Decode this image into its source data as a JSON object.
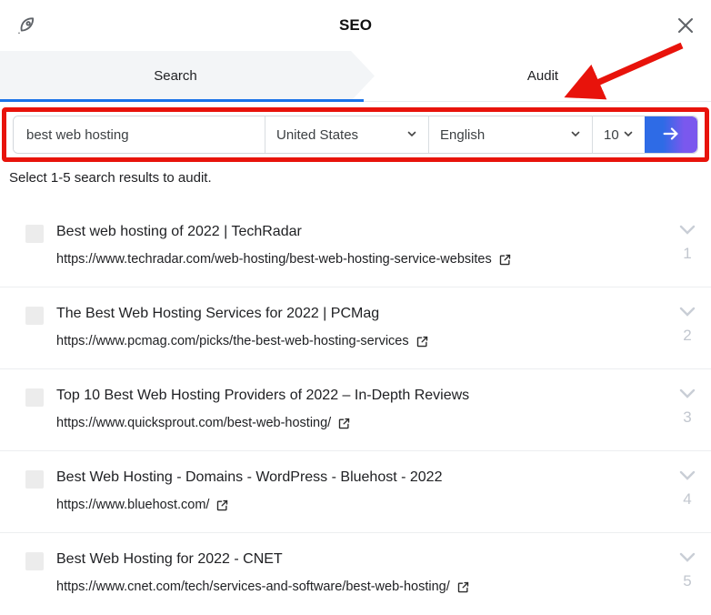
{
  "header": {
    "title": "SEO"
  },
  "tabs": {
    "search_label": "Search",
    "audit_label": "Audit"
  },
  "search": {
    "query": "best web hosting",
    "country": "United States",
    "language": "English",
    "result_count": "10"
  },
  "instruction": "Select 1-5 search results to audit.",
  "results": [
    {
      "rank": "1",
      "title": "Best web hosting of 2022 | TechRadar",
      "url": "https://www.techradar.com/web-hosting/best-web-hosting-service-websites"
    },
    {
      "rank": "2",
      "title": "The Best Web Hosting Services for 2022 | PCMag",
      "url": "https://www.pcmag.com/picks/the-best-web-hosting-services"
    },
    {
      "rank": "3",
      "title": "Top 10 Best Web Hosting Providers of 2022 – In-Depth Reviews",
      "url": "https://www.quicksprout.com/best-web-hosting/"
    },
    {
      "rank": "4",
      "title": "Best Web Hosting - Domains - WordPress - Bluehost - 2022",
      "url": "https://www.bluehost.com/"
    },
    {
      "rank": "5",
      "title": "Best Web Hosting for 2022 - CNET",
      "url": "https://www.cnet.com/tech/services-and-software/best-web-hosting/"
    }
  ],
  "colors": {
    "active_tab_underline": "#1a73e8",
    "tab_inactive_bg": "#f3f5f7",
    "annotation_red": "#e8130b",
    "button_gradient_start": "#2e6be6",
    "button_gradient_end": "#7a58ee",
    "muted_gray": "#c2c7cf"
  }
}
